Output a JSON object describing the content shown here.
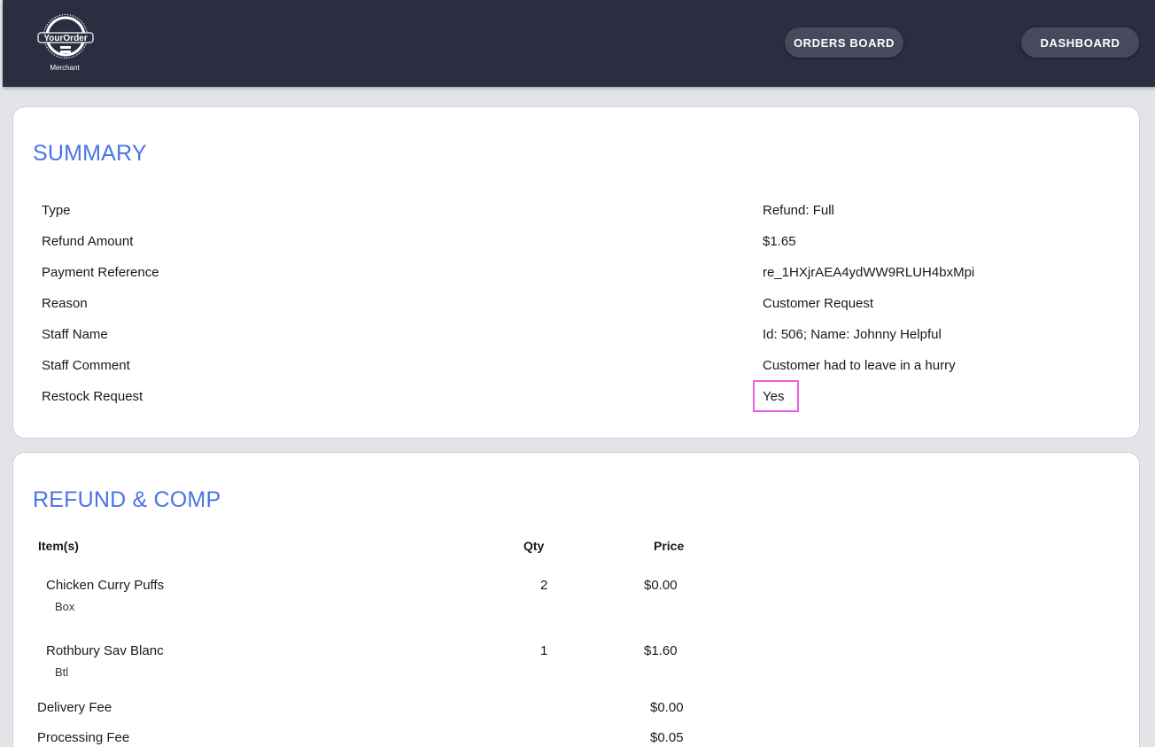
{
  "header": {
    "logo_text": "YourOrder",
    "logo_sub": "Merchant",
    "nav": {
      "orders_board": "ORDERS BOARD",
      "dashboard": "DASHBOARD"
    }
  },
  "summary": {
    "title": "SUMMARY",
    "rows": [
      {
        "label": "Type",
        "value": "Refund: Full"
      },
      {
        "label": "Refund Amount",
        "value": "$1.65"
      },
      {
        "label": "Payment Reference",
        "value": "re_1HXjrAEA4ydWW9RLUH4bxMpi"
      },
      {
        "label": "Reason",
        "value": "Customer Request"
      },
      {
        "label": "Staff Name",
        "value": "Id: 506; Name: Johnny Helpful"
      },
      {
        "label": "Staff Comment",
        "value": "Customer had to leave in a hurry"
      },
      {
        "label": "Restock Request",
        "value": "Yes"
      }
    ]
  },
  "refund": {
    "title": "REFUND & COMP",
    "columns": {
      "item": "Item(s)",
      "qty": "Qty",
      "price": "Price"
    },
    "items": [
      {
        "name": "Chicken Curry Puffs",
        "unit": "Box",
        "qty": "2",
        "price": "$0.00"
      },
      {
        "name": "Rothbury Sav Blanc",
        "unit": "Btl",
        "qty": "1",
        "price": "$1.60"
      }
    ],
    "fees": [
      {
        "label": "Delivery Fee",
        "value": "$0.00"
      },
      {
        "label": "Processing Fee",
        "value": "$0.05"
      }
    ]
  },
  "colors": {
    "navbar": "#2b2e41",
    "accent": "#4a74e6",
    "highlight": "#e85fe8"
  }
}
